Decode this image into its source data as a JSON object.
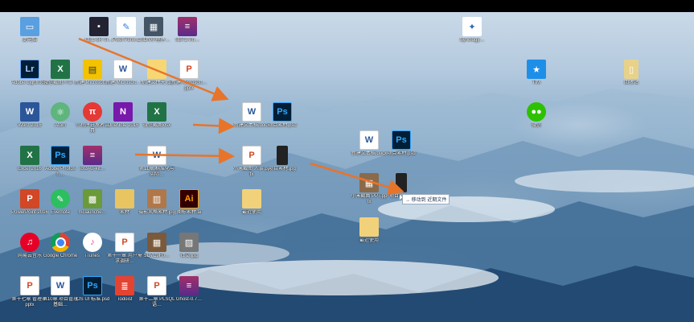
{
  "colors": {
    "arrow": "#e8742a",
    "tooltip_text": "#223355"
  },
  "desktop": {
    "row1": [
      {
        "label": "此电脑",
        "icon": "computer-icon"
      },
      {
        "label": "CB1-6R VI…",
        "icon": "monitor-icon"
      },
      {
        "label": "Pixel Perw…",
        "icon": "app-icon"
      },
      {
        "label": "CSDN小程序…",
        "icon": "app-icon"
      },
      {
        "label": "SB72-An…",
        "icon": "winrar-icon"
      }
    ],
    "row2": [
      {
        "label": "Adobe Lightroom",
        "icon": "lightroom-icon"
      },
      {
        "label": "微信截图人事…",
        "icon": "excel-icon"
      },
      {
        "label": "新建 Microsoft…",
        "icon": "word-icon"
      },
      {
        "label": "新建 Microsoft…",
        "icon": "word-icon"
      },
      {
        "label": "新建文件夹 (3)",
        "icon": "folder-icon"
      },
      {
        "label": "新建 Microsoft…pptx",
        "icon": "ppt-icon"
      }
    ],
    "row3": [
      {
        "label": "Word 2016",
        "icon": "word-icon"
      },
      {
        "label": "Atom",
        "icon": "atom-icon"
      },
      {
        "label": "小程序开发者工具",
        "icon": "pi-icon"
      },
      {
        "label": "OneNote 2016",
        "icon": "onenote-icon"
      },
      {
        "label": "微信截图xlsx",
        "icon": "excel-icon"
      }
    ],
    "row4": [
      {
        "label": "Excel 2016",
        "icon": "excel-icon"
      },
      {
        "label": "Adobe Photosh…",
        "icon": "photoshop-icon"
      },
      {
        "label": "ios9-ui-kit…",
        "icon": "winrar-icon"
      },
      {
        "label": "",
        "icon": "blank"
      },
      {
        "label": "第11章 标准化与实际…",
        "icon": "word-icon"
      }
    ],
    "row5": [
      {
        "label": "PowerPoint 2016",
        "icon": "ppt-icon"
      },
      {
        "label": "Evernote",
        "icon": "evernote-icon"
      },
      {
        "label": "mclaunche…",
        "icon": "minecraft-icon"
      },
      {
        "label": "素材",
        "icon": "folder-icon"
      },
      {
        "label": "摄影风格素材.jpg",
        "icon": "image-icon"
      },
      {
        "label": "图标素材.ai",
        "icon": "illustrator-icon"
      }
    ],
    "row6": [
      {
        "label": "网易云音乐",
        "icon": "netease-music-icon"
      },
      {
        "label": "Google Chrome",
        "icon": "chrome-icon"
      },
      {
        "label": "iTunes",
        "icon": "itunes-icon"
      },
      {
        "label": "第十一章 用户需求调研…",
        "icon": "ppt-icon"
      },
      {
        "label": "5D7C9F0…",
        "icon": "image-icon"
      },
      {
        "label": "社交.jpg",
        "icon": "image-icon"
      }
    ],
    "row7": [
      {
        "label": "第十七章 管理表.pptx",
        "icon": "ppt-icon"
      },
      {
        "label": "第10章 项目管理基础…",
        "icon": "word-icon"
      },
      {
        "label": "iOS UI 标准.psd",
        "icon": "photoshop-icon"
      },
      {
        "label": "Todoist",
        "icon": "todoist-icon"
      },
      {
        "label": "第十二章 PLSQL语…",
        "icon": "ppt-icon"
      },
      {
        "label": "Ghost-0.7…",
        "icon": "winrar-icon"
      }
    ],
    "middle": [
      {
        "label": "新建文本档.docx",
        "icon": "word-icon"
      },
      {
        "label": "项目素材.psd",
        "icon": "photoshop-icon"
      },
      {
        "label": "小米截图 人事.pptx",
        "icon": "ppt-icon"
      },
      {
        "label": "项目素材.jpg",
        "icon": "phone-image-icon"
      },
      {
        "label": "最近使用",
        "icon": "folder-icon"
      }
    ],
    "right_middle": [
      {
        "label": "新建文本档.docx",
        "icon": "word-icon"
      },
      {
        "label": "项目素材.psd",
        "icon": "photoshop-icon"
      },
      {
        "label": "小米截图 PPT.pptx",
        "icon": "image-icon"
      },
      {
        "label": "项目素材…",
        "icon": "phone-image-icon"
      },
      {
        "label": "最近使用",
        "icon": "folder-icon"
      }
    ],
    "right_col": [
      {
        "label": "Synology…",
        "icon": "synology-icon"
      },
      {
        "label": "TIM",
        "icon": "tim-icon"
      },
      {
        "label": "微信",
        "icon": "wechat-icon"
      },
      {
        "label": "回收站",
        "icon": "recycle-bin-icon"
      }
    ]
  },
  "tooltip": {
    "text": "→ 移动到 近期文件"
  }
}
